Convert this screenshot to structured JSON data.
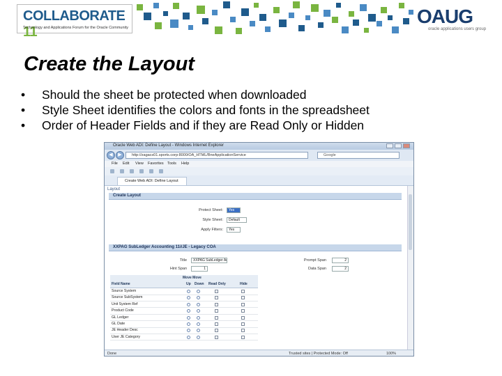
{
  "header": {
    "collaborate_logo": {
      "name": "COLLABORATE",
      "number": "11",
      "tagline": "Technology and Applications Forum for the Oracle Community"
    },
    "oaug_logo": {
      "name": "OAUG",
      "tagline": "oracle applications users group"
    },
    "accent_colors": [
      "#7ab540",
      "#1f5b8c",
      "#4a8ac4"
    ]
  },
  "slide": {
    "title": "Create the Layout",
    "bullets": [
      "Should the sheet be protected when downloaded",
      "Style Sheet identifies the colors and fonts in the spreadsheet",
      "Order of Header Fields and if they are Read Only or Hidden"
    ]
  },
  "browser": {
    "window_title": "Oracle Web ADI: Define Layout - Windows Internet Explorer",
    "url": "http://zagacs01.sports.corp:8000/OA_HTML/BneApplicationService",
    "search_engine": "Google",
    "menu": [
      "File",
      "Edit",
      "View",
      "Favorites",
      "Tools",
      "Help"
    ],
    "tab_label": "Create Web ADI: Define Layout",
    "status_left": "Done",
    "status_middle": "Trusted sites | Protected Mode: Off",
    "zoom": "100%"
  },
  "page": {
    "heading": "Layout",
    "section_create": "Create Layout",
    "protect_sheet": {
      "label": "Protect Sheet:",
      "value": "Yes"
    },
    "style_sheet": {
      "label": "Style Sheet:",
      "value": "Default"
    },
    "apply_filters": {
      "label": "Apply Filters:",
      "value": "Yes"
    },
    "section_subledger": "XXPAG SubLedger Accounting 11i/JE - Legacy COA",
    "title_field": {
      "label": "Title",
      "value": "XXPAG SubLedger Accou"
    },
    "hint_span": {
      "label": "Hint Span",
      "value": "1"
    },
    "prompt_span": {
      "label": "Prompt Span",
      "value": "2"
    },
    "data_span": {
      "label": "Data Span",
      "value": "2"
    },
    "grid_headers": {
      "move": "Move Move",
      "field_name": "Field Name",
      "up": "Up",
      "down": "Down",
      "read_only": "Read Only",
      "hide": "Hide"
    },
    "fields": [
      "Source System",
      "Source SubSystem",
      "Unit System Ref",
      "Product Code",
      "GL Ledger",
      "GL Date",
      "JE Header Desc",
      "User JE Category"
    ]
  }
}
